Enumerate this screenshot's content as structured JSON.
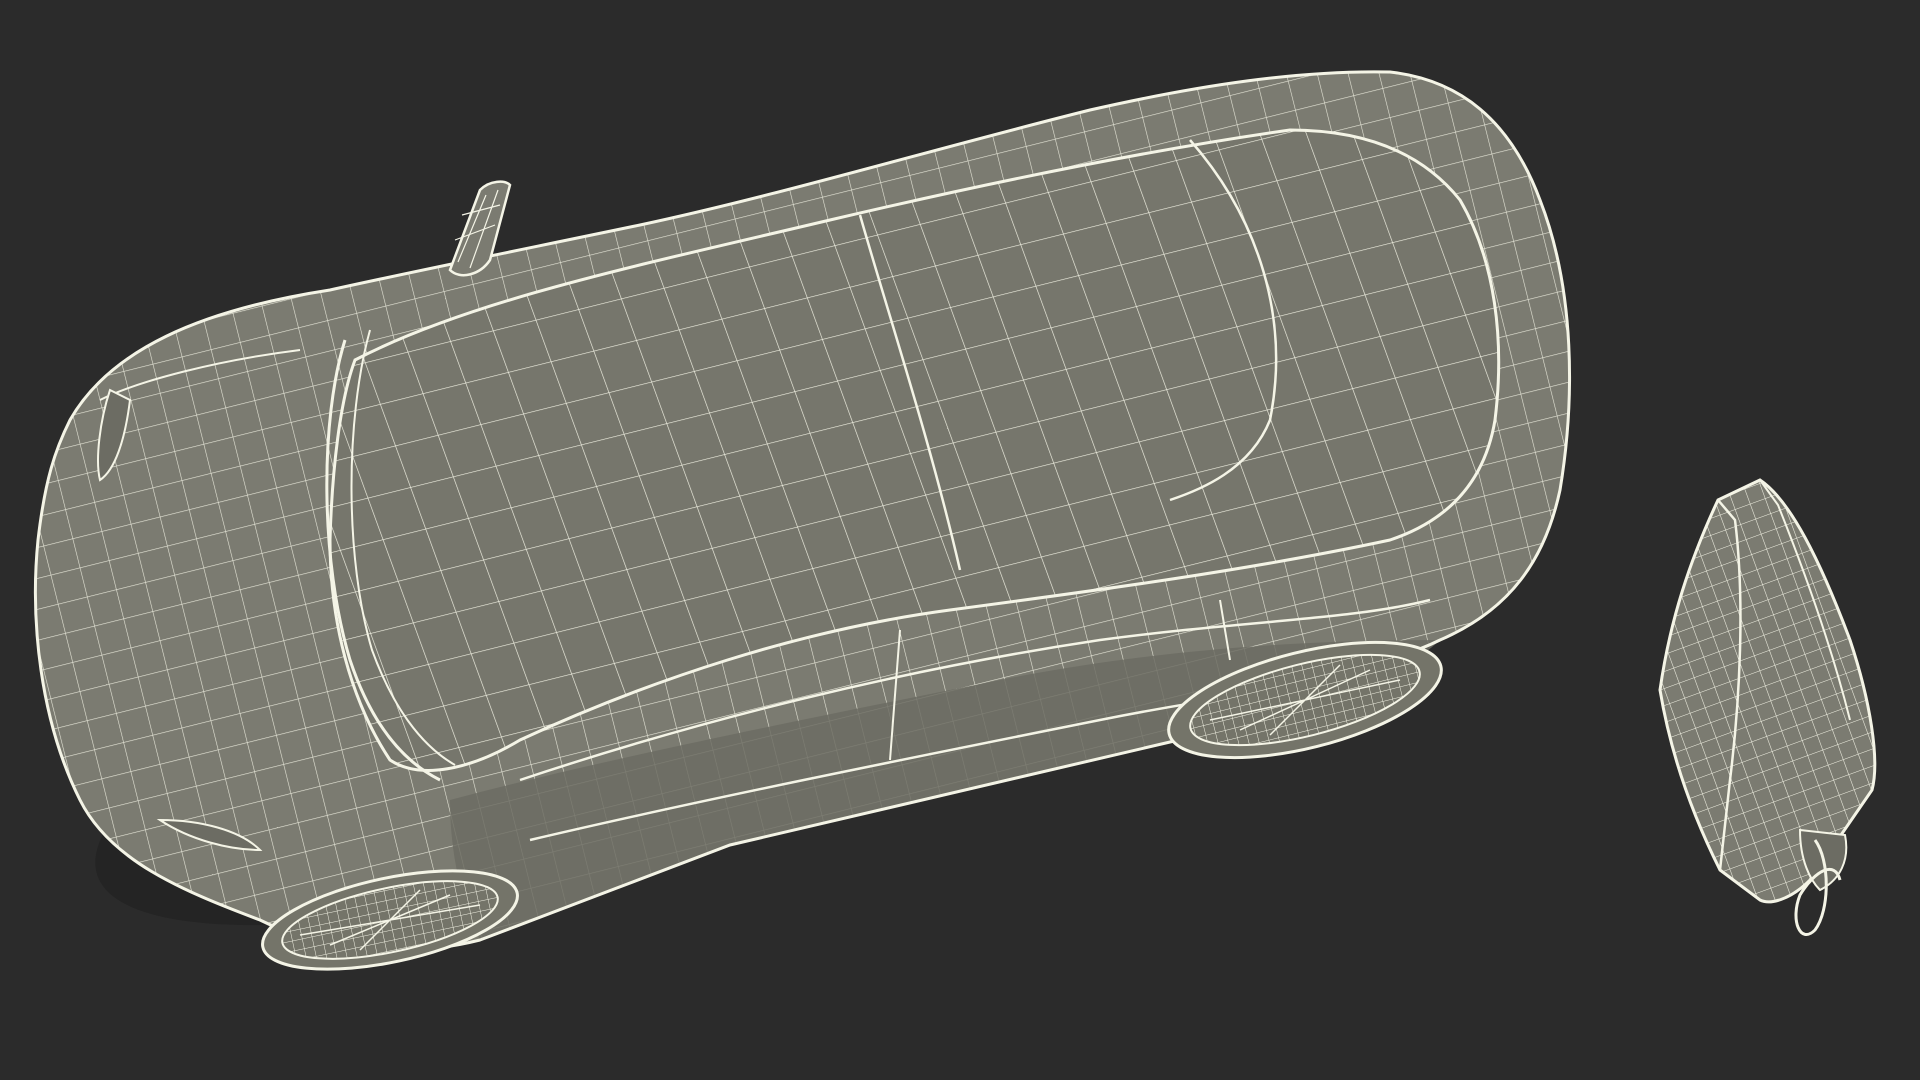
{
  "scene": {
    "description_visible_text": "",
    "objects": [
      {
        "name": "electric-car",
        "style": "wireframe"
      },
      {
        "name": "wall-charger",
        "style": "wireframe"
      }
    ]
  },
  "colors": {
    "background": "#2b2b2b",
    "surface": "#7a7a70",
    "surface_dark": "#67675e",
    "wire": "#f2f2e4",
    "shadow": "#1f1f1f"
  }
}
